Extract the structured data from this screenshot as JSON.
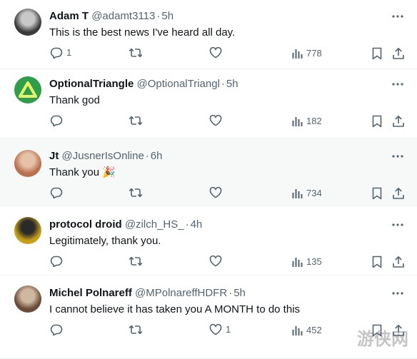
{
  "tweets": [
    {
      "name": "Adam T",
      "handle": "@adamt3113",
      "sep": "·",
      "time": "5h",
      "text": "This is the best news I've heard all day.",
      "emoji": "",
      "replies": "1",
      "retweets": "",
      "likes": "",
      "views": "778",
      "avatar_colors": [
        "#3a3a3a",
        "#c8c8c8"
      ]
    },
    {
      "name": "OptionalTriangle",
      "handle": "@OptionalTriangl",
      "sep": "·",
      "time": "5h",
      "text": "Thank god",
      "emoji": "",
      "replies": "",
      "retweets": "",
      "likes": "",
      "views": "182",
      "avatar_colors": [
        "#2e9e4a",
        "#a6d94f"
      ]
    },
    {
      "name": "Jt",
      "handle": "@JusnerIsOnline",
      "sep": "·",
      "time": "6h",
      "text": "Thank you",
      "emoji": "🎉",
      "replies": "",
      "retweets": "",
      "likes": "",
      "views": "734",
      "avatar_colors": [
        "#b8704e",
        "#e5c2a8"
      ]
    },
    {
      "name": "protocol droid",
      "handle": "@zilch_HS_",
      "sep": "·",
      "time": "4h",
      "text": "Legitimately, thank you.",
      "emoji": "",
      "replies": "",
      "retweets": "",
      "likes": "",
      "views": "135",
      "avatar_colors": [
        "#c8a018",
        "#2a2a2a"
      ]
    },
    {
      "name": "Michel Polnareff",
      "handle": "@MPolnareffHDFR",
      "sep": "·",
      "time": "5h",
      "text": "I cannot believe it has taken you A MONTH to do this",
      "emoji": "",
      "replies": "",
      "retweets": "",
      "likes": "1",
      "views": "452",
      "avatar_colors": [
        "#6a4a38",
        "#d0b8a0"
      ]
    }
  ],
  "watermark": "游侠网",
  "colors": {
    "muted": "#536471",
    "text": "#0f1419",
    "divider": "#eff3f4",
    "highlight": "#f7f9f9"
  }
}
